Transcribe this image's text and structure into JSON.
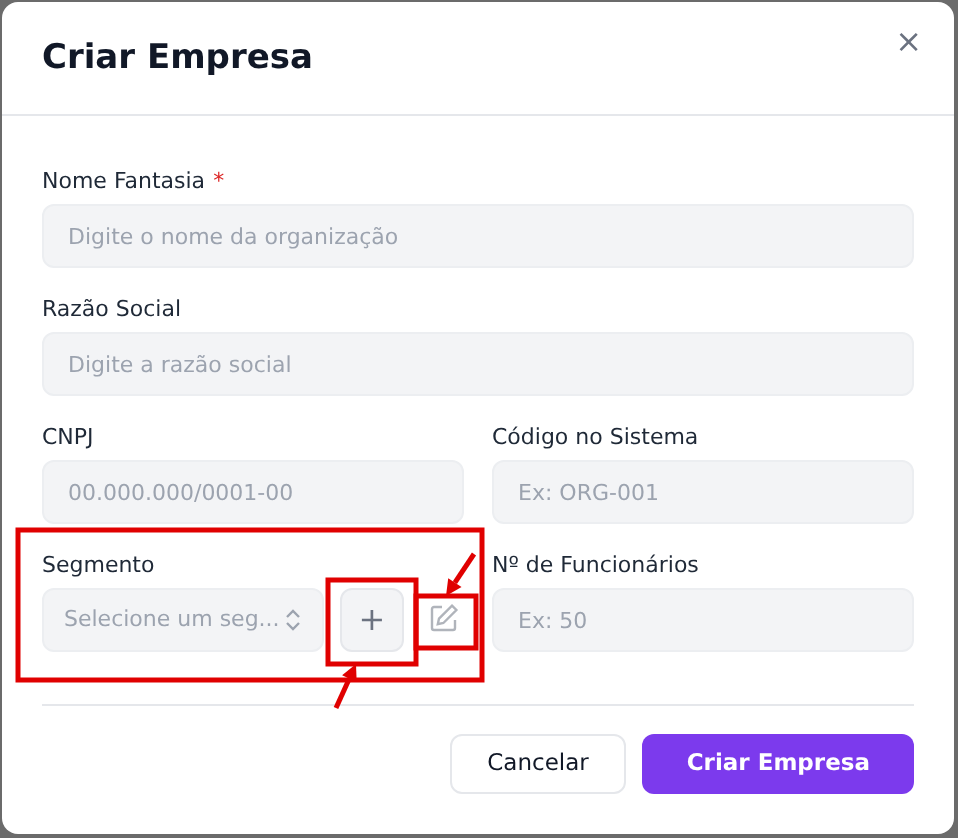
{
  "dialog": {
    "title": "Criar Empresa",
    "close": "×"
  },
  "rows": [
    [
      {
        "label": "Nome Fantasia",
        "required_mark": "*",
        "placeholder": "Digite o nome da organização",
        "kind": "text"
      }
    ],
    [
      {
        "label": "Razão Social",
        "placeholder": "Digite a razão social",
        "kind": "text"
      }
    ],
    [
      {
        "label": "CNPJ",
        "placeholder": "00.000.000/0001-00",
        "kind": "text"
      },
      {
        "label": "Código no Sistema",
        "placeholder": "Ex: ORG-001",
        "kind": "text"
      }
    ],
    [
      {
        "label": "Segmento",
        "placeholder": "Selecione um seg...",
        "kind": "select",
        "highlighted": true,
        "add_button": {
          "label": "+",
          "highlighted": true
        },
        "edit_button": {
          "highlighted": true
        }
      },
      {
        "label": "Nº de Funcionários",
        "placeholder": "Ex: 50",
        "kind": "text"
      }
    ]
  ],
  "buttons": [
    {
      "label": "Cancelar",
      "kind": "secondary"
    },
    {
      "label": "Criar Empresa",
      "kind": "primary"
    }
  ]
}
